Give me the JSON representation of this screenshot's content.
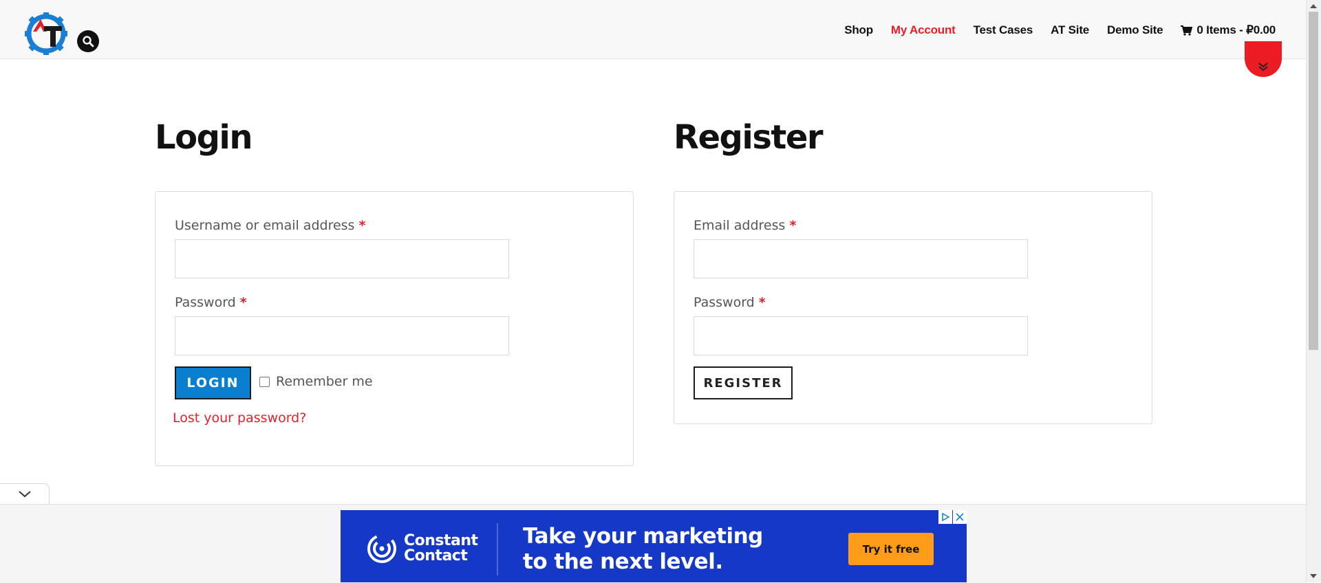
{
  "header": {
    "nav": [
      {
        "label": "Shop",
        "active": false
      },
      {
        "label": "My Account",
        "active": true
      },
      {
        "label": "Test Cases",
        "active": false
      },
      {
        "label": "AT Site",
        "active": false
      },
      {
        "label": "Demo Site",
        "active": false
      }
    ],
    "cart_label": "0 Items - ₽0.00",
    "icons": {
      "logo": "automation-testing-gear-logo",
      "search": "search-icon",
      "cart": "cart-icon",
      "scroll": "double-chevron-down-icon"
    }
  },
  "login": {
    "title": "Login",
    "username_label": "Username or email address",
    "username_value": "",
    "password_label": "Password",
    "password_value": "",
    "required_mark": "*",
    "button_label": "LOGIN",
    "remember_label": "Remember me",
    "remember_checked": false,
    "lost_password_link": "Lost your password?"
  },
  "register": {
    "title": "Register",
    "email_label": "Email address",
    "email_value": "",
    "password_label": "Password",
    "password_value": "",
    "required_mark": "*",
    "button_label": "REGISTER"
  },
  "ad": {
    "brand_line1": "Constant",
    "brand_line2": "Contact",
    "headline_line1": "Take your marketing",
    "headline_line2": "to the next level.",
    "cta": "Try it free"
  },
  "colors": {
    "accent_red": "#e5202a",
    "login_blue": "#0a7fd0",
    "ad_blue": "#1638c7",
    "ad_cta_orange": "#ff9c1a"
  }
}
